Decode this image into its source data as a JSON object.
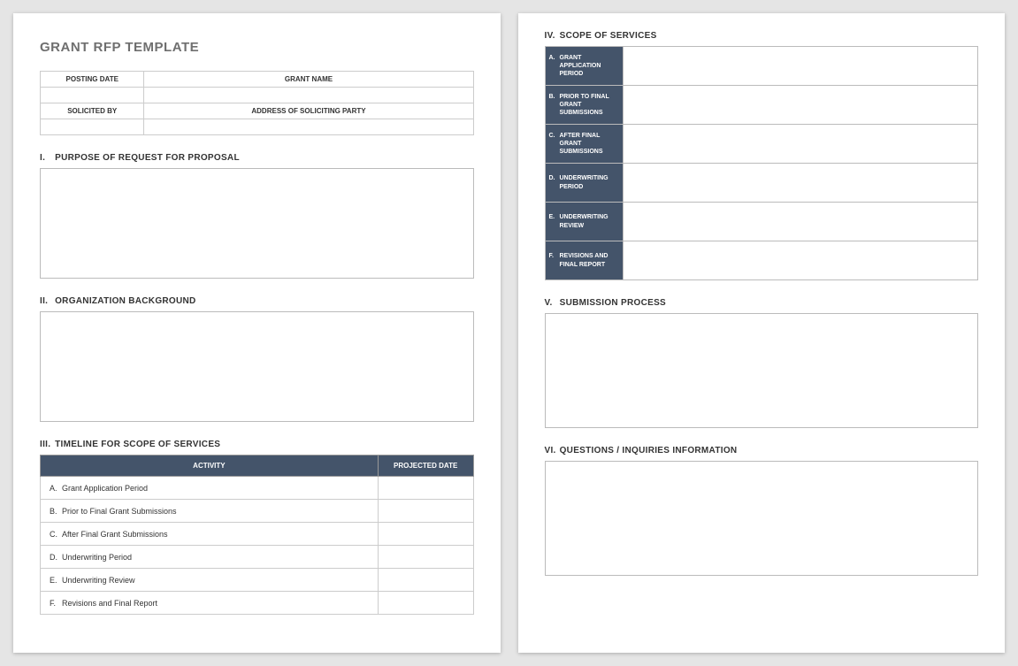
{
  "title": "GRANT RFP TEMPLATE",
  "header_fields": {
    "posting_date_label": "POSTING DATE",
    "grant_name_label": "GRANT NAME",
    "solicited_by_label": "SOLICITED BY",
    "address_label": "ADDRESS OF SOLICITING PARTY",
    "posting_date_value": "",
    "grant_name_value": "",
    "solicited_by_value": "",
    "address_value": ""
  },
  "sections": {
    "s1": {
      "num": "I.",
      "title": "PURPOSE OF REQUEST FOR PROPOSAL"
    },
    "s2": {
      "num": "II.",
      "title": "ORGANIZATION BACKGROUND"
    },
    "s3": {
      "num": "III.",
      "title": "TIMELINE FOR SCOPE OF SERVICES"
    },
    "s4": {
      "num": "IV.",
      "title": "SCOPE OF SERVICES"
    },
    "s5": {
      "num": "V.",
      "title": "SUBMISSION PROCESS"
    },
    "s6": {
      "num": "VI.",
      "title": "QUESTIONS / INQUIRIES INFORMATION"
    }
  },
  "timeline": {
    "col_activity": "ACTIVITY",
    "col_date": "PROJECTED DATE",
    "rows": [
      {
        "marker": "A.",
        "label": "Grant Application Period",
        "date": ""
      },
      {
        "marker": "B.",
        "label": "Prior to Final Grant Submissions",
        "date": ""
      },
      {
        "marker": "C.",
        "label": "After Final Grant Submissions",
        "date": ""
      },
      {
        "marker": "D.",
        "label": "Underwriting Period",
        "date": ""
      },
      {
        "marker": "E.",
        "label": "Underwriting Review",
        "date": ""
      },
      {
        "marker": "F.",
        "label": "Revisions and Final Report",
        "date": ""
      }
    ]
  },
  "scope": {
    "rows": [
      {
        "marker": "A.",
        "label": "GRANT APPLICATION PERIOD",
        "value": ""
      },
      {
        "marker": "B.",
        "label": "PRIOR TO FINAL GRANT SUBMISSIONS",
        "value": ""
      },
      {
        "marker": "C.",
        "label": "AFTER FINAL GRANT SUBMISSIONS",
        "value": ""
      },
      {
        "marker": "D.",
        "label": "UNDERWRITING PERIOD",
        "value": ""
      },
      {
        "marker": "E.",
        "label": "UNDERWRITING REVIEW",
        "value": ""
      },
      {
        "marker": "F.",
        "label": "REVISIONS AND FINAL REPORT",
        "value": ""
      }
    ]
  }
}
